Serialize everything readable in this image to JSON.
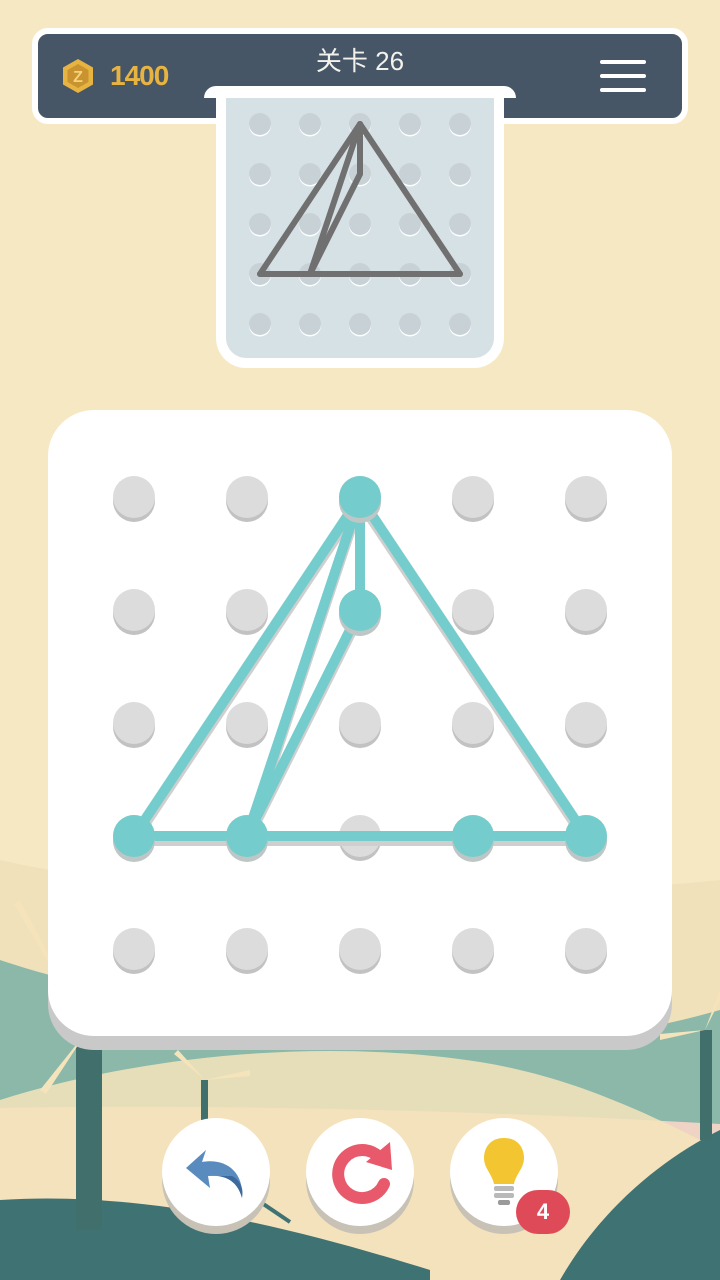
{
  "header": {
    "coins": "1400",
    "level_label": "关卡  26"
  },
  "board": {
    "grid_cols": 5,
    "grid_rows": 5,
    "edges": [
      [
        [
          2,
          0
        ],
        [
          2,
          1
        ]
      ],
      [
        [
          2,
          0
        ],
        [
          0,
          3
        ]
      ],
      [
        [
          2,
          0
        ],
        [
          1,
          3
        ]
      ],
      [
        [
          2,
          0
        ],
        [
          4,
          3
        ]
      ],
      [
        [
          2,
          1
        ],
        [
          1,
          3
        ]
      ],
      [
        [
          0,
          3
        ],
        [
          1,
          3
        ]
      ],
      [
        [
          1,
          3
        ],
        [
          3,
          3
        ]
      ],
      [
        [
          3,
          3
        ],
        [
          4,
          3
        ]
      ]
    ],
    "active_nodes": [
      [
        2,
        0
      ],
      [
        2,
        1
      ],
      [
        0,
        3
      ],
      [
        1,
        3
      ],
      [
        3,
        3
      ],
      [
        4,
        3
      ]
    ]
  },
  "controls": {
    "hint_count": "4"
  },
  "colors": {
    "accent": "#74cccc",
    "peg": "#dcdcdc",
    "header_bg": "#465667",
    "coin": "#e8b441",
    "target_line": "#707070",
    "badge": "#df4a58"
  },
  "icons": {
    "coin": "coin-icon",
    "menu": "hamburger-menu-icon",
    "undo": "undo-arrow-icon",
    "restart": "restart-icon",
    "hint": "lightbulb-icon"
  }
}
